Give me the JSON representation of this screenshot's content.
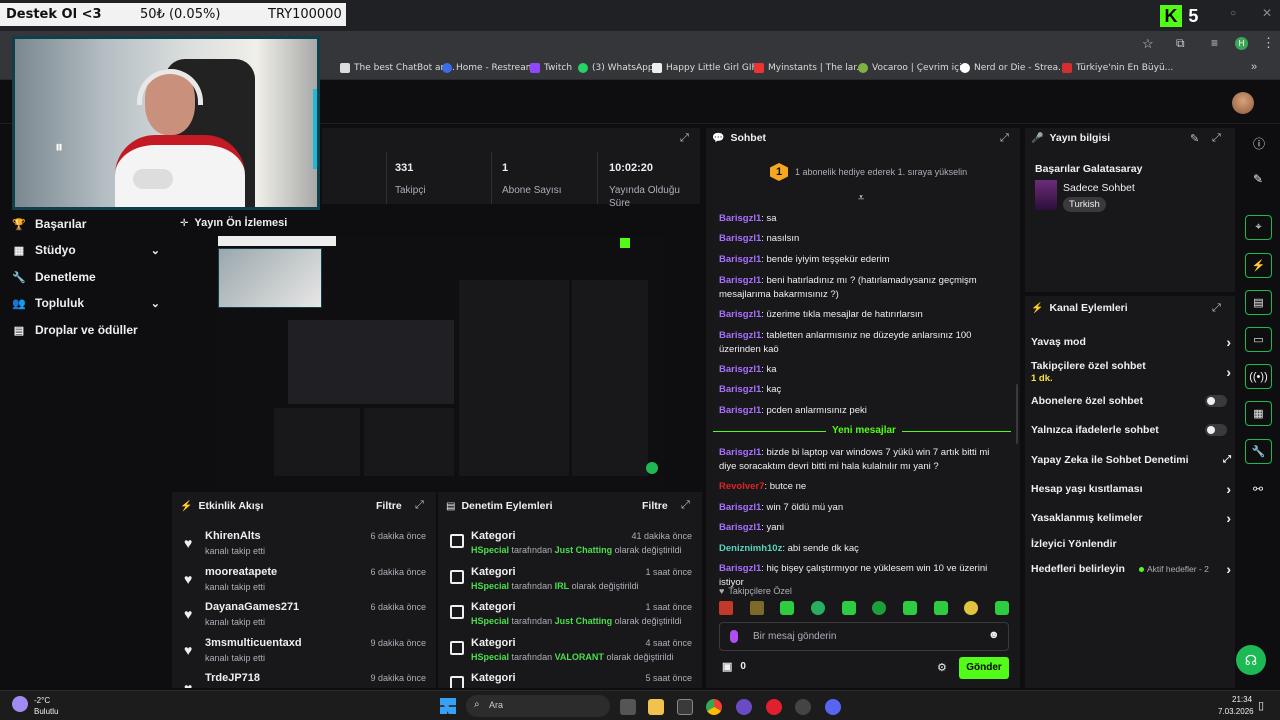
{
  "overlay": {
    "donation_title": "Destek Ol <3",
    "donation_amount": "50₺ (0.05%)",
    "donation_goal": "TRY100000"
  },
  "browser": {
    "bookmarks": [
      "The best ChatBot an...",
      "Home - Restream",
      "Twitch",
      "(3) WhatsApp",
      "Happy Little Girl GIF...",
      "Myinstants | The lar...",
      "Vocaroo | Çevrim içi...",
      "Nerd or Die - Strea...",
      "Türkiye'nin En Büyü..."
    ],
    "profile_initial": "H"
  },
  "brand": {
    "logo": "K",
    "logo_num": "5"
  },
  "nav": {
    "items": [
      {
        "label": "Başarılar",
        "icon": "trophy-icon"
      },
      {
        "label": "Stüdyo",
        "icon": "studio-icon",
        "chevron": true
      },
      {
        "label": "Denetleme",
        "icon": "wrench-icon"
      },
      {
        "label": "Topluluk",
        "icon": "community-icon",
        "chevron": true
      },
      {
        "label": "Droplar ve ödüller",
        "icon": "gift-icon"
      }
    ]
  },
  "stats": [
    {
      "value": "331",
      "label": "Takipçi"
    },
    {
      "value": "1",
      "label": "Abone Sayısı"
    },
    {
      "value": "10:02:20",
      "label": "Yayında Olduğu Süre"
    }
  ],
  "preview": {
    "title": "Yayın Ön İzlemesi"
  },
  "activity": {
    "title": "Etkinlik Akışı",
    "filter": "Filtre",
    "items": [
      {
        "user": "KhirenAlts",
        "text": "kanalı takip etti",
        "time": "6 dakika önce"
      },
      {
        "user": "mooreatapete",
        "text": "kanalı takip etti",
        "time": "6 dakika önce"
      },
      {
        "user": "DayanaGames271",
        "text": "kanalı takip etti",
        "time": "6 dakika önce"
      },
      {
        "user": "3msmulticuentaxd",
        "text": "kanalı takip etti",
        "time": "9 dakika önce"
      },
      {
        "user": "TrdeJP718",
        "text": "",
        "time": "9 dakika önce"
      }
    ]
  },
  "moderation": {
    "title": "Denetim Eylemleri",
    "filter": "Filtre",
    "items": [
      {
        "kind": "Kategori",
        "by": "HSpecial",
        "mid": "tarafından",
        "cat": "Just Chatting",
        "tail": "olarak değiştirildi",
        "time": "41 dakika önce"
      },
      {
        "kind": "Kategori",
        "by": "HSpecial",
        "mid": "tarafından",
        "cat": "IRL",
        "tail": "olarak değiştirildi",
        "time": "1 saat önce"
      },
      {
        "kind": "Kategori",
        "by": "HSpecial",
        "mid": "tarafından",
        "cat": "Just Chatting",
        "tail": "olarak değiştirildi",
        "time": "1 saat önce"
      },
      {
        "kind": "Kategori",
        "by": "HSpecial",
        "mid": "tarafından",
        "cat": "VALORANT",
        "tail": "olarak değiştirildi",
        "time": "4 saat önce"
      },
      {
        "kind": "Kategori",
        "by": "",
        "mid": "",
        "cat": "",
        "tail": "",
        "time": "5 saat önce"
      }
    ]
  },
  "chat": {
    "title": "Sohbet",
    "pinned_rank": "1",
    "pinned_text": "1 abonelik hediye ederek 1. sıraya yükselin",
    "new_messages": "Yeni mesajlar",
    "messages_before": [
      {
        "user": "Barisgzl1",
        "text": ": sa"
      },
      {
        "user": "Barisgzl1",
        "text": ": nasılsın"
      },
      {
        "user": "Barisgzl1",
        "text": ": bende iyiyim teşşekür ederim"
      },
      {
        "user": "Barisgzl1",
        "text": ": beni hatırladınız mı ? (hatırlamadıysanız geçmişm mesajlarıma bakarmısınız ?)"
      },
      {
        "user": "Barisgzl1",
        "text": ": üzerime tıkla mesajlar de hatırırlarsın"
      },
      {
        "user": "Barisgzl1",
        "text": ": tabletten anlarmısınız ne düzeyde anlarsınız 100 üzerinden kaö"
      },
      {
        "user": "Barisgzl1",
        "text": ": ka"
      },
      {
        "user": "Barisgzl1",
        "text": ": kaç"
      },
      {
        "user": "Barisgzl1",
        "text": ": pcden anlarmısınız peki"
      }
    ],
    "messages_after": [
      {
        "user": "Barisgzl1",
        "text": ": bizde bi laptop var windows 7 yükü win 7 artık bitti mi diye soracaktım devri bitti mi hala kulalnılır mı yani ?",
        "color": "purple"
      },
      {
        "user": "Revolver7",
        "text": ": butce ne",
        "color": "red"
      },
      {
        "user": "Barisgzl1",
        "text": ": win 7 öldü mü yan",
        "color": "purple"
      },
      {
        "user": "Barisgzl1",
        "text": ": yani",
        "color": "purple"
      },
      {
        "user": "Deniznimh10z",
        "text": ": abi sende dk kaç",
        "color": "teal"
      },
      {
        "user": "Barisgzl1",
        "text": ": hiç bişey çalıştırmıyor ne yüklesem win 10 ve üzerini istiyor",
        "color": "purple"
      }
    ],
    "followers_only": "Takipçilere Özel",
    "input_placeholder": "Bir mesaj gönderin",
    "points": "0",
    "send": "Gönder"
  },
  "stream_info": {
    "title": "Yayın bilgisi",
    "stream_title": "Başarılar Galatasaray",
    "category": "Sadece Sohbet",
    "tag": "Turkish"
  },
  "channel_actions": {
    "title": "Kanal Eylemleri",
    "items": [
      {
        "label": "Yavaş mod",
        "control": "arrow"
      },
      {
        "label": "Takipçilere özel sohbet",
        "sub": "1 dk.",
        "control": "arrow"
      },
      {
        "label": "Abonelere özel sohbet",
        "control": "toggle"
      },
      {
        "label": "Yalnızca ifadelerle sohbet",
        "control": "toggle"
      },
      {
        "label": "Yapay Zeka ile Sohbet Denetimi",
        "control": "external"
      },
      {
        "label": "Hesap yaşı kısıtlaması",
        "control": "arrow"
      },
      {
        "label": "Yasaklanmış kelimeler",
        "control": "arrow"
      },
      {
        "label": "İzleyici Yönlendir",
        "control": "none"
      },
      {
        "label": "Hedefleri belirleyin",
        "control": "arrow",
        "badge": "Aktif hedefler - 2"
      }
    ]
  },
  "taskbar": {
    "weather_temp": "-2°C",
    "weather_desc": "Bulutlu",
    "search": "Ara",
    "time": "21:34",
    "date": "7.03.2026"
  },
  "colors": {
    "accent_green": "#53fc18",
    "username_purple": "#a970ff",
    "panel_bg": "#18181b",
    "page_bg": "#0e0e10"
  }
}
